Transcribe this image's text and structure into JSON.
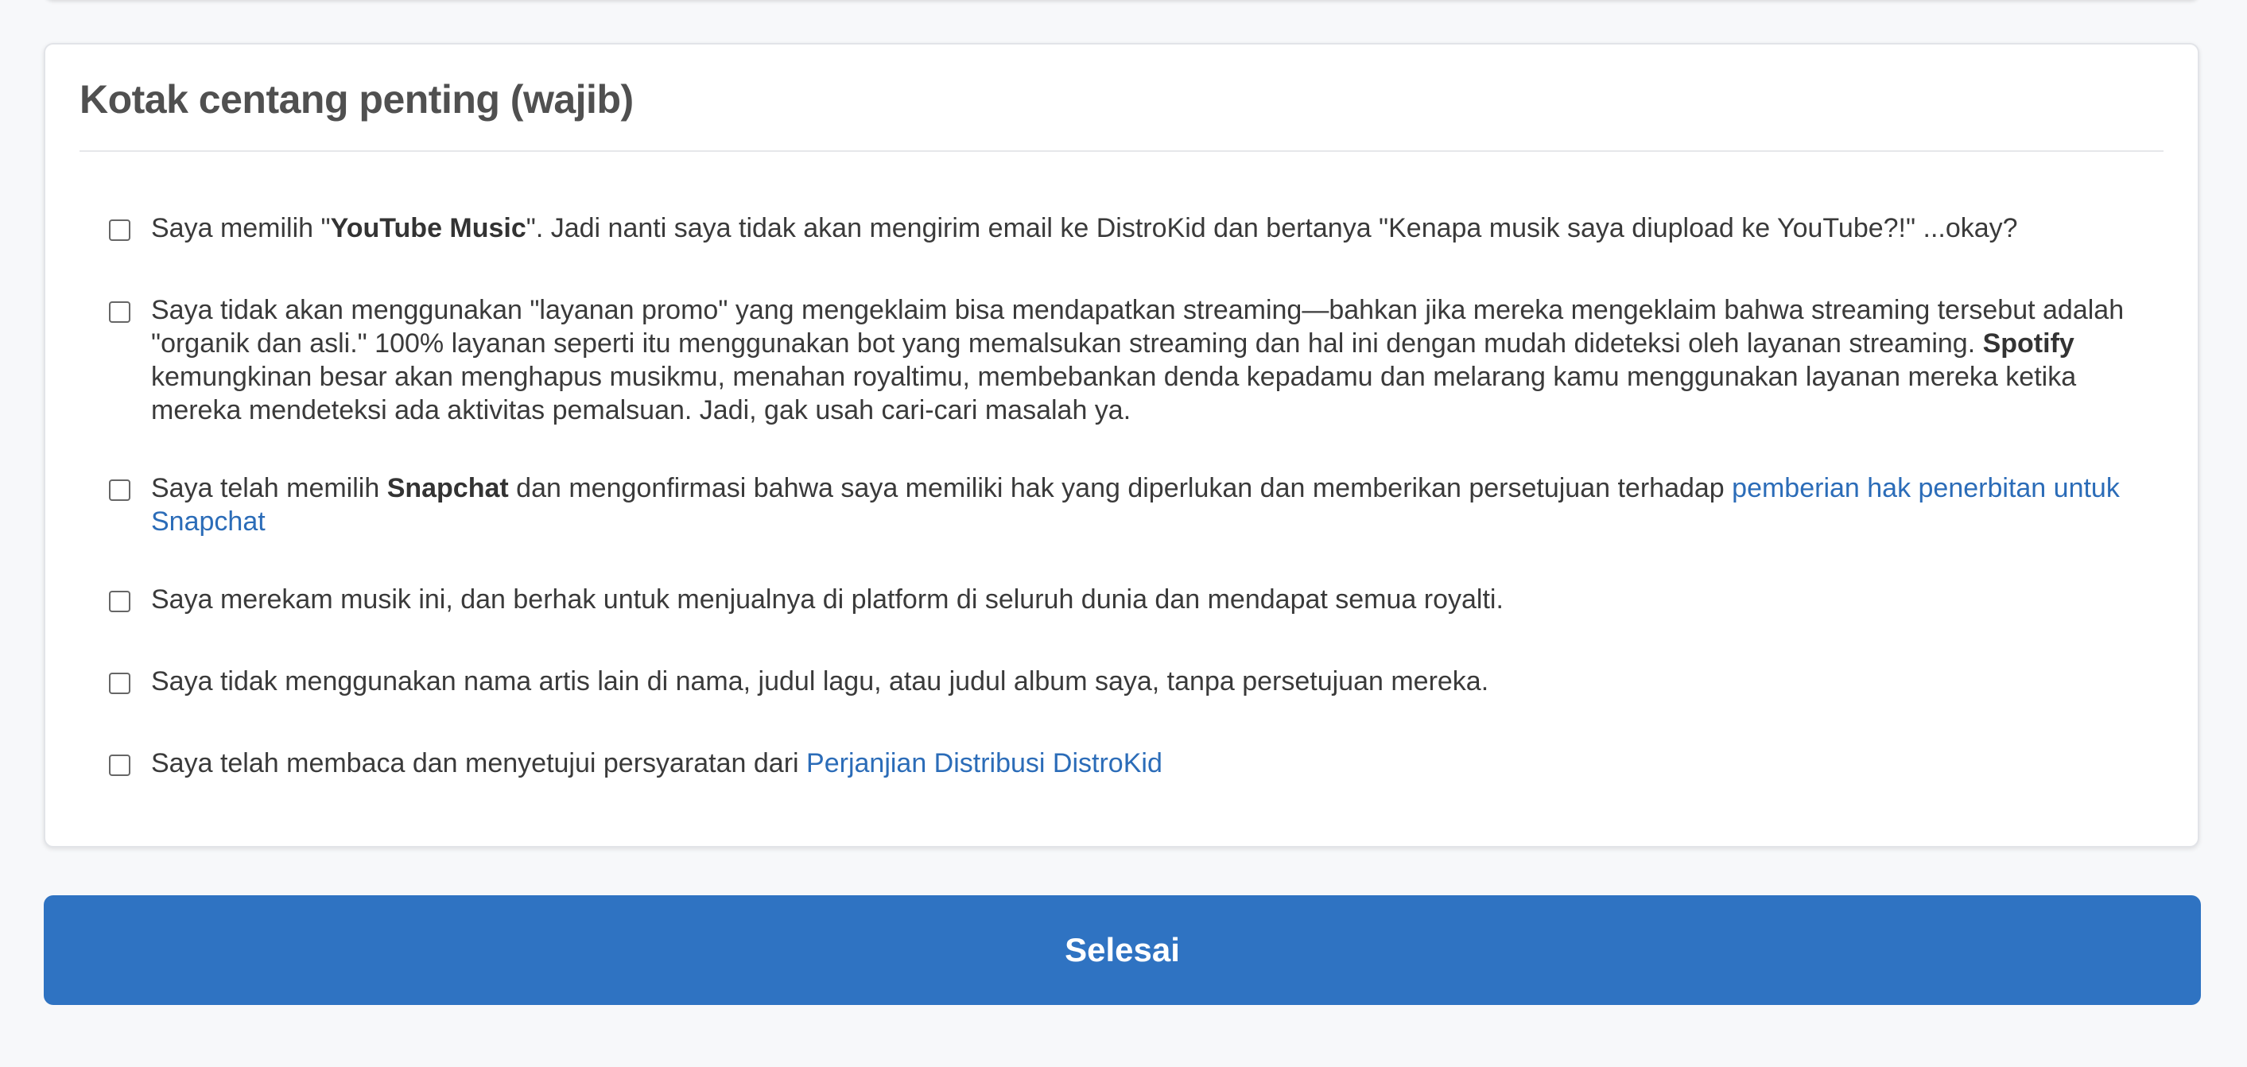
{
  "section": {
    "title": "Kotak centang penting (wajib)"
  },
  "checkboxes": [
    {
      "t1": "Saya memilih \"",
      "b1": "YouTube Music",
      "t2": "\". Jadi nanti saya tidak akan mengirim email ke DistroKid dan bertanya \"Kenapa musik saya diupload ke YouTube?!\" ...okay?"
    },
    {
      "t1": "Saya tidak akan menggunakan \"layanan promo\" yang mengeklaim bisa mendapatkan streaming—bahkan jika mereka mengeklaim bahwa streaming tersebut adalah \"organik dan asli.\" 100% layanan seperti itu menggunakan bot yang memalsukan streaming dan hal ini dengan mudah dideteksi oleh layanan streaming. ",
      "b1": "Spotify",
      "t2": " kemungkinan besar akan menghapus musikmu, menahan royaltimu, membebankan denda kepadamu dan melarang kamu menggunakan layanan mereka ketika mereka mendeteksi ada aktivitas pemalsuan. Jadi, gak usah cari-cari masalah ya."
    },
    {
      "t1": "Saya telah memilih ",
      "b1": "Snapchat",
      "t2": " dan mengonfirmasi bahwa saya memiliki hak yang diperlukan dan memberikan persetujuan terhadap ",
      "link": "pemberian hak penerbitan untuk Snapchat"
    },
    {
      "t1": "Saya merekam musik ini, dan berhak untuk menjualnya di platform di seluruh dunia dan mendapat semua royalti."
    },
    {
      "t1": "Saya tidak menggunakan nama artis lain di nama, judul lagu, atau judul album saya, tanpa persetujuan mereka."
    },
    {
      "t1": "Saya telah membaca dan menyetujui persyaratan dari ",
      "link": "Perjanjian Distribusi DistroKid"
    }
  ],
  "submit": {
    "label": "Selesai"
  },
  "colors": {
    "accent": "#2f73c2",
    "link": "#2b6cb8",
    "background": "#f7f8fa"
  }
}
